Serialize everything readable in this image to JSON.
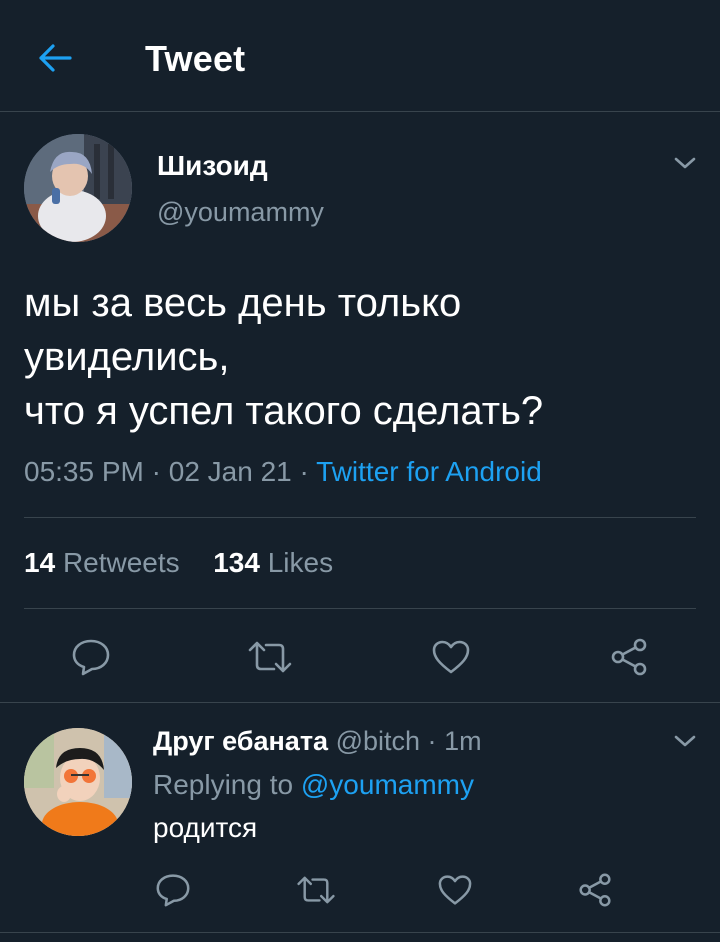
{
  "header": {
    "title": "Tweet",
    "back_icon": "arrow-left-icon",
    "accent": "#1da1f2",
    "background": "#15202b"
  },
  "tweet": {
    "author_name": "Шизоид",
    "author_handle": "@youmammy",
    "text_lines": [
      "мы за весь день только",
      "увиделись,",
      "что я успел такого сделать?"
    ],
    "time": "05:35 PM",
    "date": "02 Jan 21",
    "separator": "·",
    "source": "Twitter for Android",
    "retweets_count": "14",
    "retweets_label": "Retweets",
    "likes_count": "134",
    "likes_label": "Likes",
    "actions": [
      "reply-icon",
      "retweet-icon",
      "heart-icon",
      "share-icon"
    ]
  },
  "reply": {
    "author_name": "Друг ебаната",
    "author_handle": "@bitch",
    "separator": "·",
    "time": "1m",
    "replying_prefix": "Replying to",
    "replying_to": "@youmammy",
    "text": "родится",
    "actions": [
      "reply-icon",
      "retweet-icon",
      "heart-icon",
      "share-icon"
    ]
  }
}
